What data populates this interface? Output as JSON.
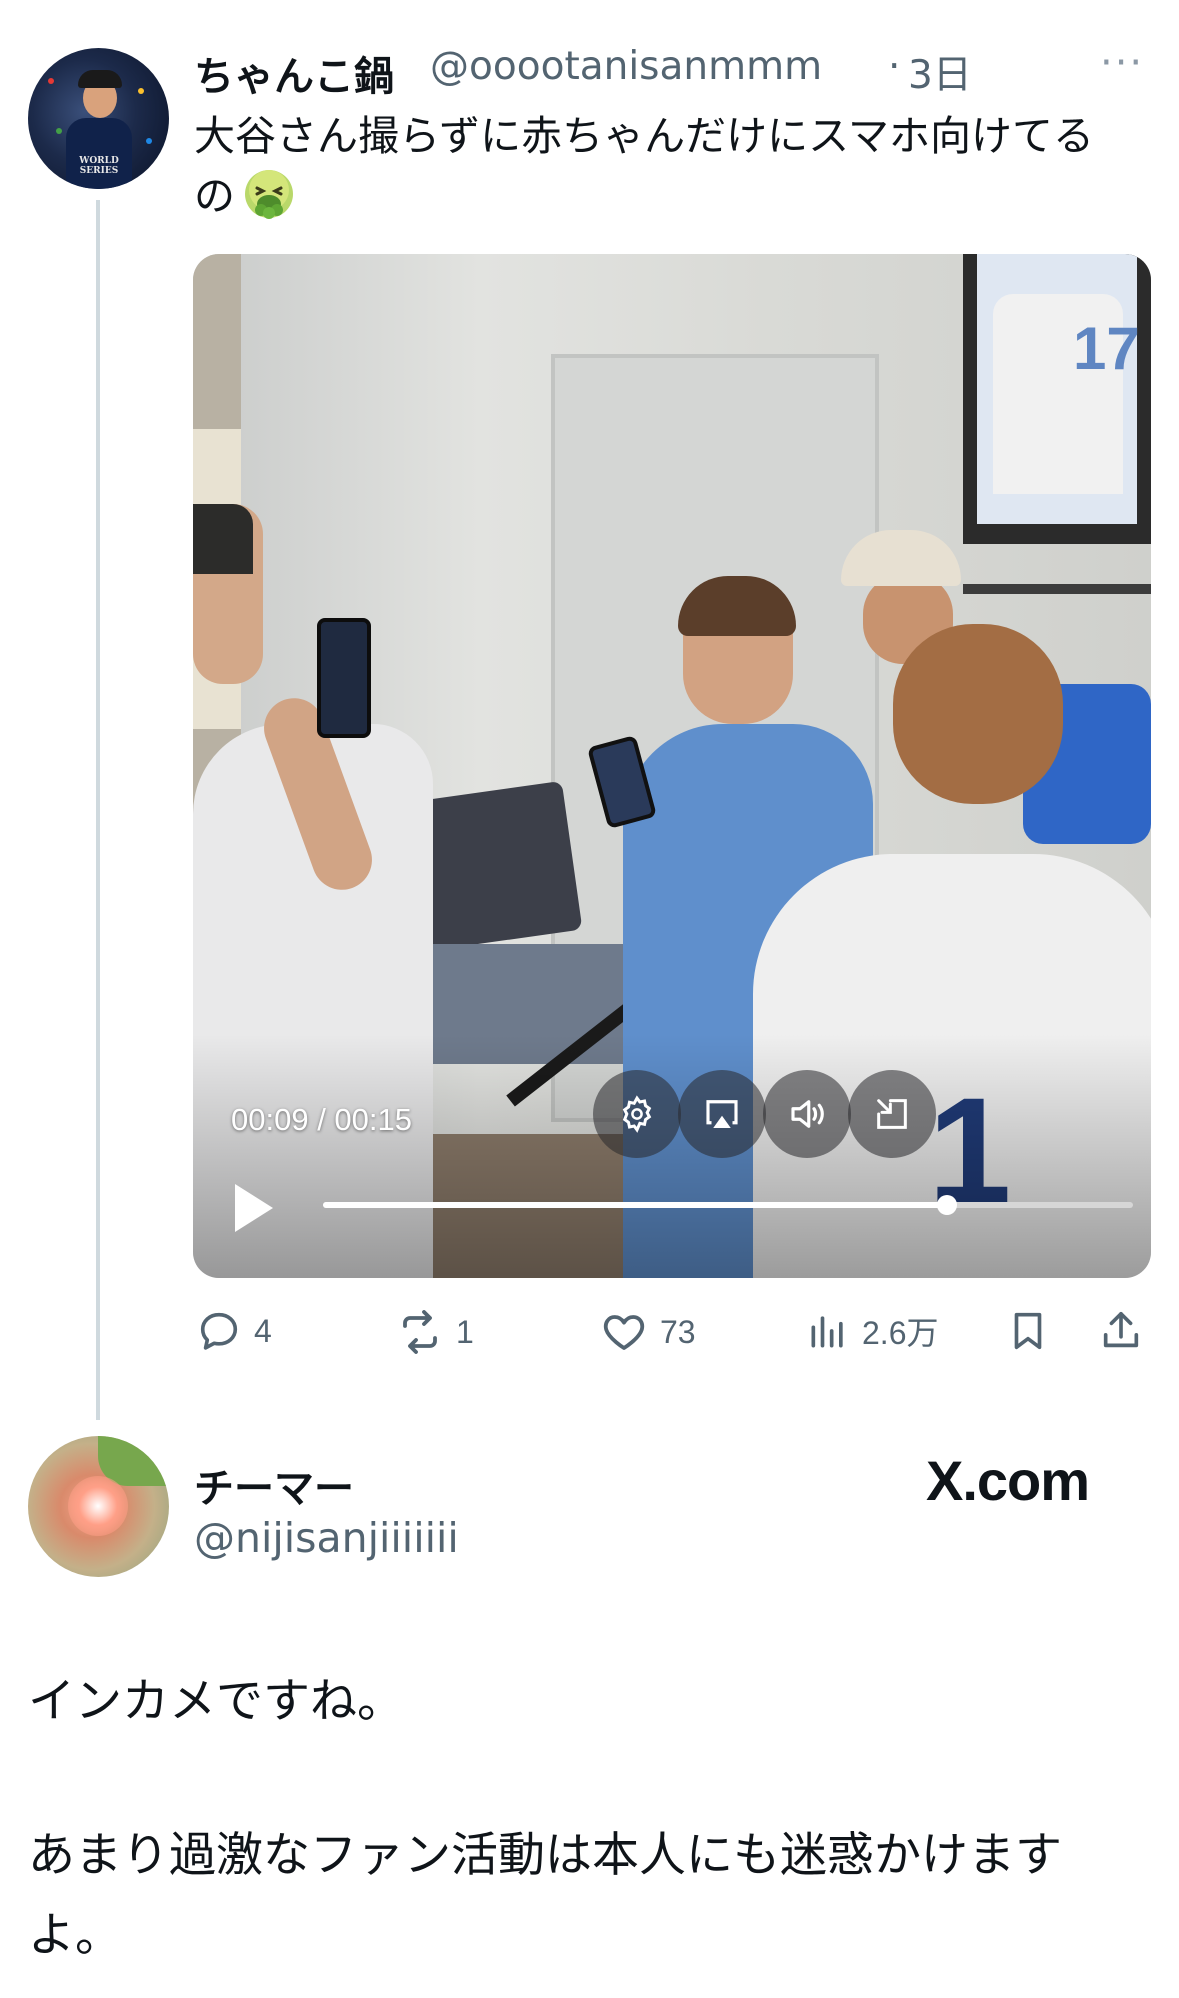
{
  "tweet": {
    "author_name": "ちゃんこ鍋",
    "author_handle": "@ooootanisanmmm",
    "separator": "·",
    "time": "3日",
    "more": "···",
    "text": "大谷さん撮らずに赤ちゃんだけにスマホ向けてるの",
    "emoji": "nauseated-face-emoji",
    "avatar_text": "WORLD SERIES"
  },
  "video": {
    "time_label": "00:09 / 00:15",
    "progress_fraction": 0.77,
    "scene_labels": {
      "jersey_number_back": "17",
      "jersey_number_front": "1"
    },
    "controls": [
      "settings-icon",
      "airplay-icon",
      "volume-icon",
      "popout-icon",
      "play-icon"
    ]
  },
  "actions": {
    "replies": "4",
    "reposts": "1",
    "likes": "73",
    "views": "2.6万"
  },
  "reply": {
    "author_name": "チーマー",
    "author_handle": "@nijisanjiiiiiii",
    "watermark": "X.com",
    "paragraph1": "インカメですね。",
    "paragraph2": "あまり過激なファン活動は本人にも迷惑かけますよ。"
  },
  "colors": {
    "text": "#0f1419",
    "secondary": "#536471",
    "thread_line": "#cfd9de"
  }
}
